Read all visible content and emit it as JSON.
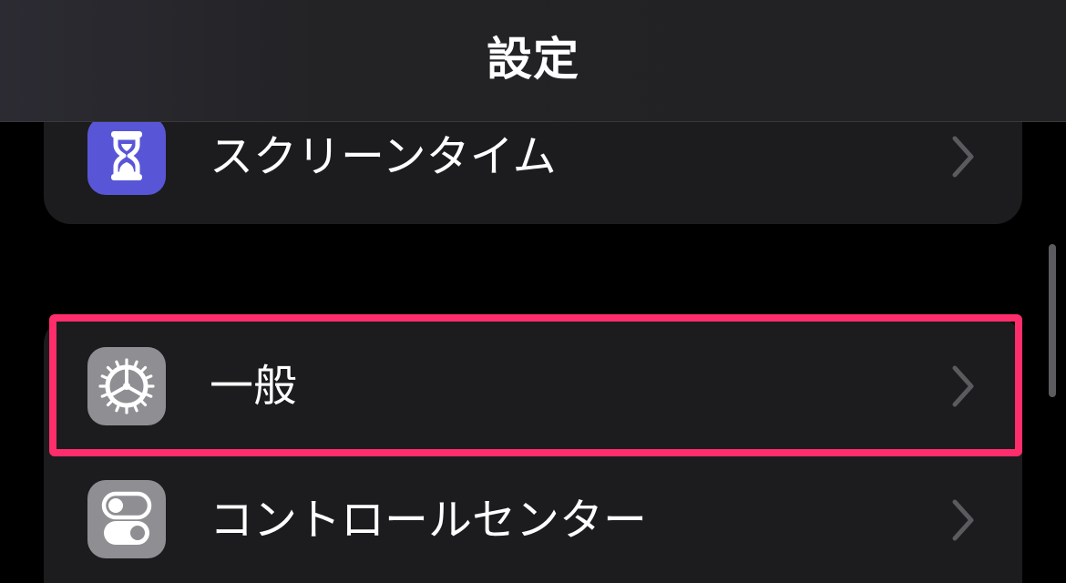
{
  "nav": {
    "title": "設定"
  },
  "rows": [
    {
      "label": "スクリーンタイム",
      "icon": "hourglass-icon",
      "icon_color": "#5856d6"
    },
    {
      "label": "一般",
      "icon": "gear-icon",
      "icon_color": "#8e8e93",
      "highlighted": true
    },
    {
      "label": "コントロールセンター",
      "icon": "toggles-icon",
      "icon_color": "#8e8e93"
    }
  ],
  "colors": {
    "background": "#000000",
    "group_background": "#1c1c1e",
    "highlight": "#ff2d6b",
    "chevron": "#5a5a5f",
    "text": "#ffffff"
  }
}
